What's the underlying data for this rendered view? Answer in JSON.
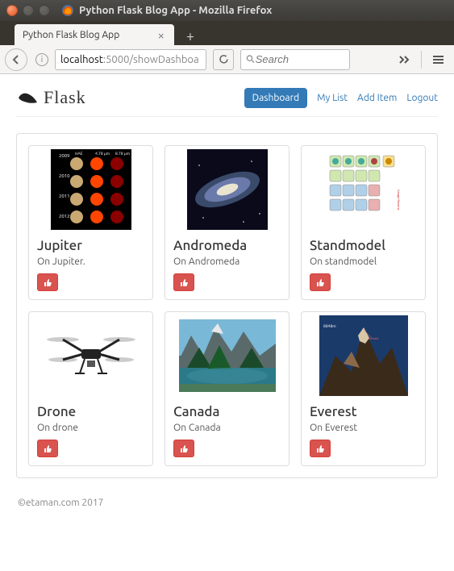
{
  "window": {
    "title": "Python Flask Blog App - Mozilla Firefox"
  },
  "tab": {
    "title": "Python Flask Blog App"
  },
  "url": {
    "host": "localhost",
    "port_path": ":5000/showDashboa"
  },
  "search": {
    "placeholder": "Search"
  },
  "brand": "Flask",
  "nav": {
    "dashboard": "Dashboard",
    "mylist": "My List",
    "additem": "Add Item",
    "logout": "Logout"
  },
  "cards": [
    {
      "title": "Jupiter",
      "desc": "On Jupiter."
    },
    {
      "title": "Andromeda",
      "desc": "On Andromeda"
    },
    {
      "title": "Standmodel",
      "desc": "On standmodel"
    },
    {
      "title": "Drone",
      "desc": "On drone"
    },
    {
      "title": "Canada",
      "desc": "On Canada"
    },
    {
      "title": "Everest",
      "desc": "On Everest"
    }
  ],
  "footer": "©etaman.com 2017"
}
